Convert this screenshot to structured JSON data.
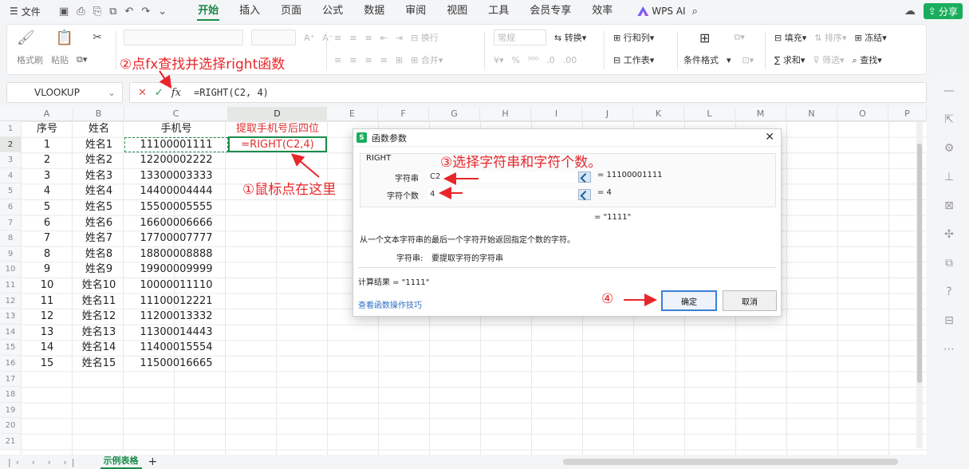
{
  "menubar": {
    "file": "文件",
    "tabs": [
      "开始",
      "插入",
      "页面",
      "公式",
      "数据",
      "审阅",
      "视图",
      "工具",
      "会员专享",
      "效率"
    ],
    "active_tab": "开始",
    "wps_ai": "WPS AI",
    "share": "分享"
  },
  "ribbon": {
    "clipboard": {
      "format_brush": "格式刷",
      "paste": "粘贴"
    },
    "align": {
      "wrap": "换行",
      "merge": "合并"
    },
    "number": {
      "format": "常规",
      "convert": "转换"
    },
    "rowcol": {
      "rows_cols": "行和列",
      "worksheet": "工作表"
    },
    "cond_format": "条件格式",
    "fill": "填充",
    "sort": "排序",
    "freeze": "冻结",
    "sum": "求和",
    "filter": "筛选",
    "find": "查找"
  },
  "formula_bar": {
    "name_box": "VLOOKUP",
    "formula": "=RIGHT(C2, 4)"
  },
  "columns": [
    "A",
    "B",
    "C",
    "D",
    "E",
    "F",
    "G",
    "H",
    "I",
    "J",
    "K",
    "L",
    "M",
    "N",
    "O",
    "P"
  ],
  "row_numbers": [
    "1",
    "2",
    "3",
    "4",
    "5",
    "6",
    "7",
    "8",
    "9",
    "10",
    "11",
    "12",
    "13",
    "14",
    "15",
    "16",
    "17",
    "18",
    "19",
    "20",
    "21"
  ],
  "table": {
    "headers": [
      "序号",
      "姓名",
      "手机号",
      "提取手机号后四位"
    ],
    "rows": [
      [
        "1",
        "姓名1",
        "11100001111"
      ],
      [
        "2",
        "姓名2",
        "12200002222"
      ],
      [
        "3",
        "姓名3",
        "13300003333"
      ],
      [
        "4",
        "姓名4",
        "14400004444"
      ],
      [
        "5",
        "姓名5",
        "15500005555"
      ],
      [
        "6",
        "姓名6",
        "16600006666"
      ],
      [
        "7",
        "姓名7",
        "17700007777"
      ],
      [
        "8",
        "姓名8",
        "18800008888"
      ],
      [
        "9",
        "姓名9",
        "19900009999"
      ],
      [
        "10",
        "姓名10",
        "10000011110"
      ],
      [
        "11",
        "姓名11",
        "11100012221"
      ],
      [
        "12",
        "姓名12",
        "11200013332"
      ],
      [
        "13",
        "姓名13",
        "11300014443"
      ],
      [
        "14",
        "姓名14",
        "11400015554"
      ],
      [
        "15",
        "姓名15",
        "11500016665"
      ]
    ],
    "d2_formula": "=RIGHT(C2,4)"
  },
  "dialog": {
    "title": "函数参数",
    "func_name": "RIGHT",
    "arg1_label": "字符串",
    "arg1_value": "C2",
    "arg1_result": "= 11100001111",
    "arg2_label": "字符个数",
    "arg2_value": "4",
    "arg2_result": "= 4",
    "result_preview": "= \"1111\"",
    "description": "从一个文本字符串的最后一个字符开始返回指定个数的字符。",
    "param_label": "字符串:",
    "param_desc": "要提取字符的字符串",
    "calc_result": "计算结果 = \"1111\"",
    "link": "查看函数操作技巧",
    "ok": "确定",
    "cancel": "取消"
  },
  "annotations": {
    "step1": "①鼠标点在这里",
    "step2": "②点fx查找并选择right函数",
    "step3": "③选择字符串和字符个数。",
    "step4": "④"
  },
  "sheet_tab": "示例表格",
  "colors": {
    "accent": "#1a8a4a",
    "annotation": "#e8262a",
    "share": "#1aad5c"
  }
}
